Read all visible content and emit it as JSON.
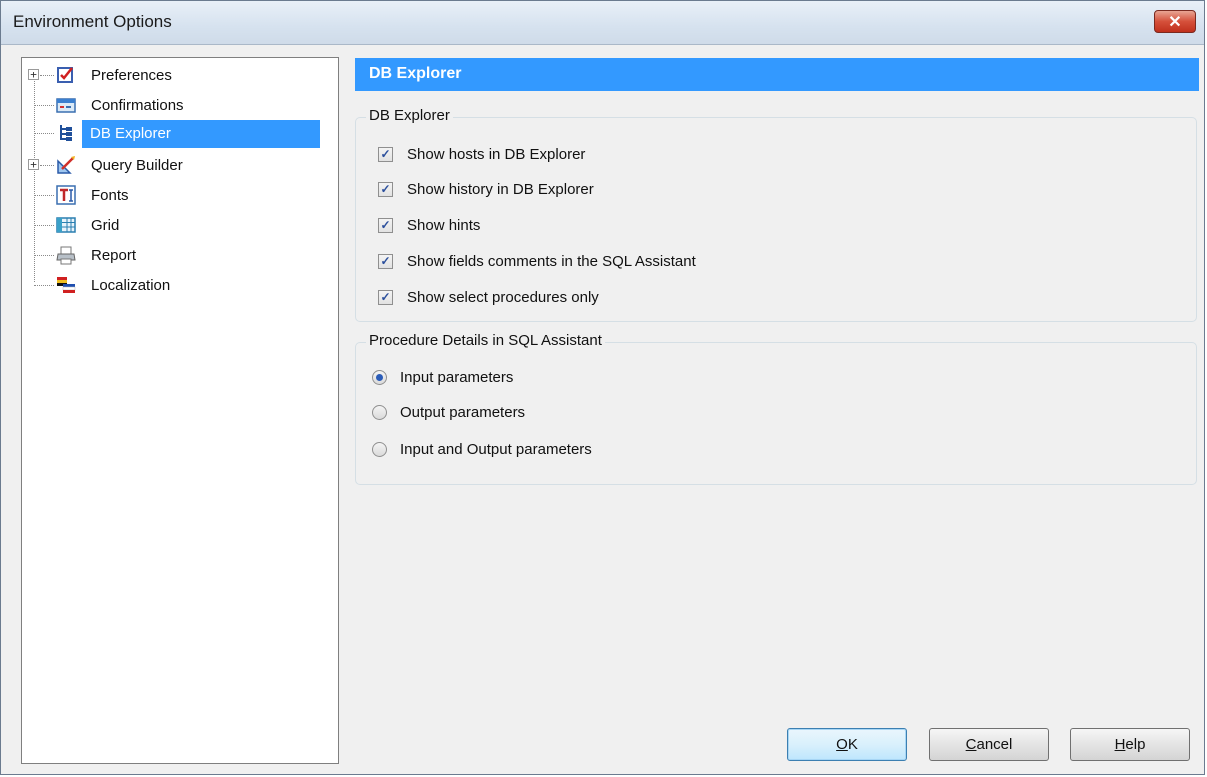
{
  "window": {
    "title": "Environment Options"
  },
  "tree": {
    "items": [
      {
        "label": "Preferences",
        "icon": "preferences-icon",
        "expandable": true
      },
      {
        "label": "Confirmations",
        "icon": "confirmations-icon",
        "expandable": false
      },
      {
        "label": "DB Explorer",
        "icon": "db-explorer-icon",
        "expandable": false,
        "selected": true
      },
      {
        "label": "Query Builder",
        "icon": "query-builder-icon",
        "expandable": true
      },
      {
        "label": "Fonts",
        "icon": "fonts-icon",
        "expandable": false
      },
      {
        "label": "Grid",
        "icon": "grid-icon",
        "expandable": false
      },
      {
        "label": "Report",
        "icon": "report-icon",
        "expandable": false
      },
      {
        "label": "Localization",
        "icon": "localization-icon",
        "expandable": false
      }
    ],
    "expand_symbol": "+"
  },
  "header": {
    "title": "DB Explorer"
  },
  "db_explorer_group": {
    "title": "DB Explorer",
    "options": [
      {
        "label": "Show hosts in DB Explorer",
        "checked": true
      },
      {
        "label": "Show history in DB Explorer",
        "checked": true
      },
      {
        "label": "Show hints",
        "checked": true
      },
      {
        "label": "Show fields comments in the SQL Assistant",
        "checked": true
      },
      {
        "label": "Show select procedures only",
        "checked": true
      }
    ],
    "check_mark": "✓"
  },
  "procedure_group": {
    "title": "Procedure Details in SQL Assistant",
    "options": [
      {
        "label": "Input parameters",
        "selected": true
      },
      {
        "label": "Output parameters",
        "selected": false
      },
      {
        "label": "Input and Output parameters",
        "selected": false
      }
    ]
  },
  "buttons": {
    "ok": {
      "mnemonic": "O",
      "rest": "K"
    },
    "cancel": {
      "mnemonic": "C",
      "rest": "ancel"
    },
    "help": {
      "mnemonic": "H",
      "rest": "elp"
    }
  },
  "close_symbol": "✕",
  "colors": {
    "accent": "#3399ff",
    "title_bar": "#d6e2ef",
    "close_button": "#c9452f"
  }
}
